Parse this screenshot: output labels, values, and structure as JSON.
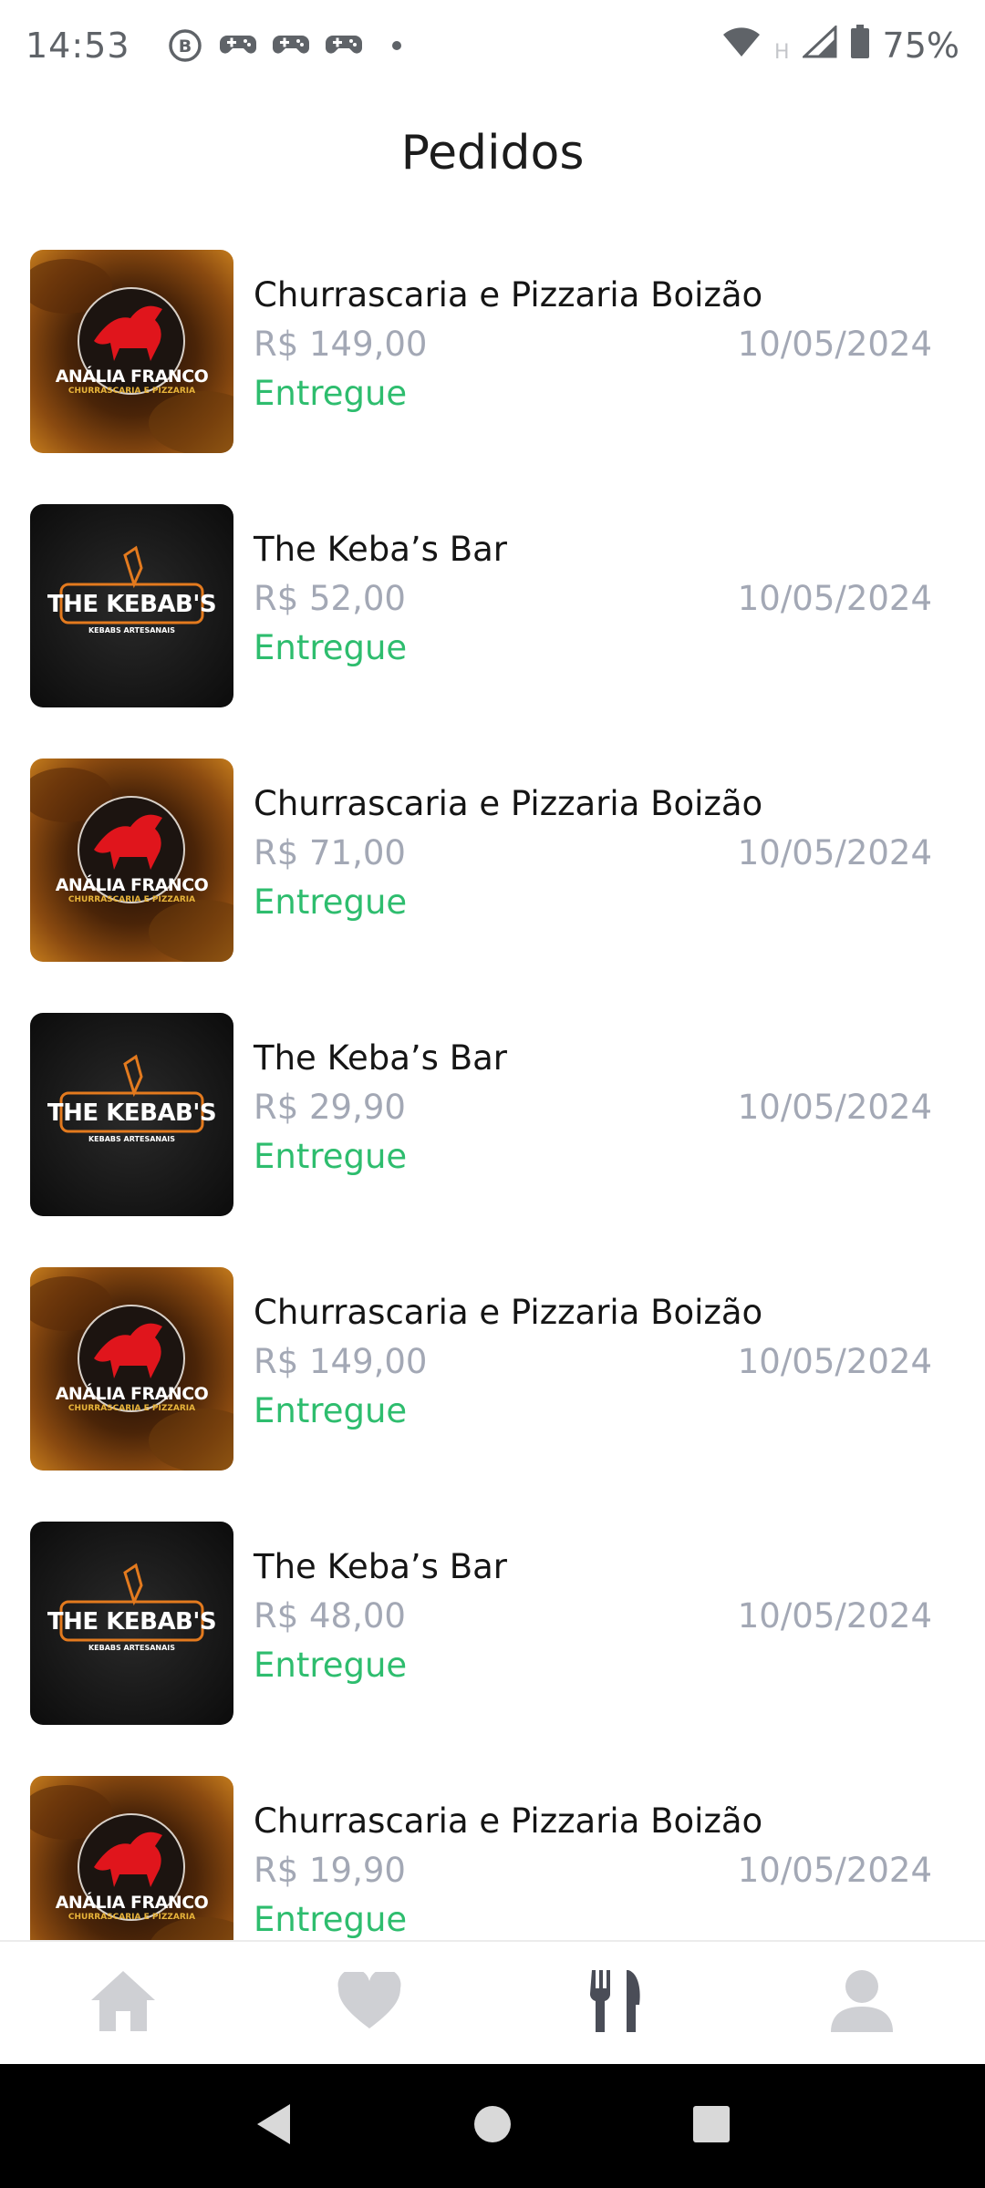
{
  "status_bar": {
    "time": "14:53",
    "network": "H",
    "battery": "75%",
    "notification_icons": [
      "b-circle-icon",
      "gamepad-icon",
      "gamepad-icon",
      "gamepad-icon",
      "dot-icon"
    ]
  },
  "header": {
    "title": "Pedidos"
  },
  "orders": [
    {
      "restaurant": "Churrascaria e Pizzaria Boizão",
      "price": "R$ 149,00",
      "date": "10/05/2024",
      "status": "Entregue",
      "logo": "analia",
      "logo_text": "ANÁLIA FRANCO",
      "logo_sub": "CHURRASCARIA E PIZZARIA"
    },
    {
      "restaurant": "The Keba’s Bar",
      "price": "R$ 52,00",
      "date": "10/05/2024",
      "status": "Entregue",
      "logo": "kebab",
      "logo_text": "THE KEBAB'S",
      "logo_sub": "KEBABS ARTESANAIS"
    },
    {
      "restaurant": "Churrascaria e Pizzaria Boizão",
      "price": "R$ 71,00",
      "date": "10/05/2024",
      "status": "Entregue",
      "logo": "analia",
      "logo_text": "ANÁLIA FRANCO",
      "logo_sub": "CHURRASCARIA E PIZZARIA"
    },
    {
      "restaurant": "The Keba’s Bar",
      "price": "R$ 29,90",
      "date": "10/05/2024",
      "status": "Entregue",
      "logo": "kebab",
      "logo_text": "THE KEBAB'S",
      "logo_sub": "KEBABS ARTESANAIS"
    },
    {
      "restaurant": "Churrascaria e Pizzaria Boizão",
      "price": "R$ 149,00",
      "date": "10/05/2024",
      "status": "Entregue",
      "logo": "analia",
      "logo_text": "ANÁLIA FRANCO",
      "logo_sub": "CHURRASCARIA E PIZZARIA"
    },
    {
      "restaurant": "The Keba’s Bar",
      "price": "R$ 48,00",
      "date": "10/05/2024",
      "status": "Entregue",
      "logo": "kebab",
      "logo_text": "THE KEBAB'S",
      "logo_sub": "KEBABS ARTESANAIS"
    },
    {
      "restaurant": "Churrascaria e Pizzaria Boizão",
      "price": "R$ 19,90",
      "date": "10/05/2024",
      "status": "Entregue",
      "logo": "analia",
      "logo_text": "ANÁLIA FRANCO",
      "logo_sub": "CHURRASCARIA E PIZZARIA"
    }
  ],
  "bottom_nav": {
    "items": [
      {
        "icon": "home-icon",
        "active": false
      },
      {
        "icon": "heart-icon",
        "active": false
      },
      {
        "icon": "fork-knife-icon",
        "active": true
      },
      {
        "icon": "user-icon",
        "active": false
      }
    ]
  },
  "colors": {
    "status_delivered": "#2ebd6e",
    "muted_text": "#a3a8b5",
    "nav_inactive": "#cfd0d4",
    "nav_active": "#4a4d57"
  }
}
